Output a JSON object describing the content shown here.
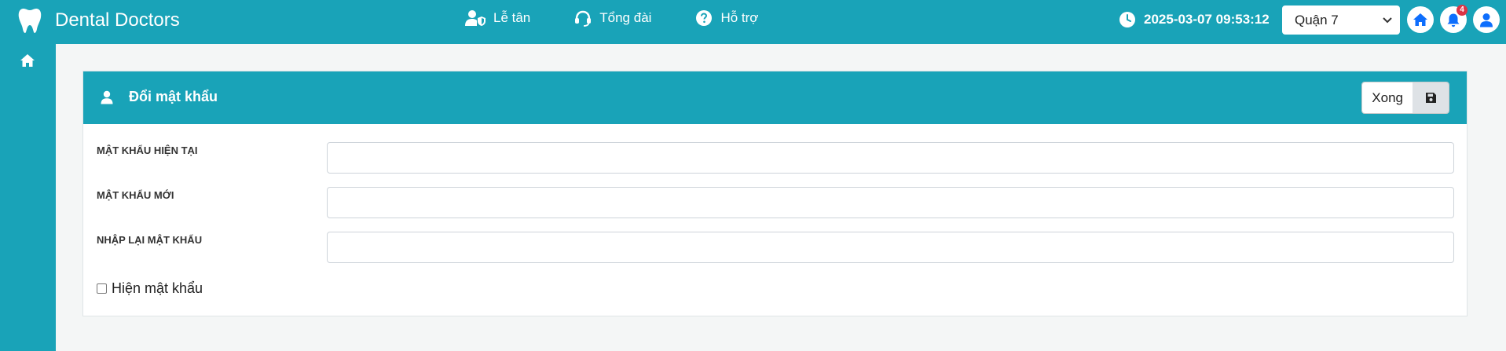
{
  "header": {
    "brand": "Dental Doctors",
    "nav": [
      {
        "label": "Lễ tân",
        "icon": "user-shield-icon"
      },
      {
        "label": "Tổng đài",
        "icon": "headset-icon"
      },
      {
        "label": "Hỗ trợ",
        "icon": "question-circle-icon"
      }
    ],
    "datetime": "2025-03-07 09:53:12",
    "branch": "Quận 7",
    "notification_count": "4"
  },
  "card": {
    "title": "Đổi mật khẩu",
    "done_label": "Xong",
    "fields": [
      {
        "label": "MẬT KHẨU HIỆN TẠI",
        "value": ""
      },
      {
        "label": "MẬT KHẨU MỚI",
        "value": ""
      },
      {
        "label": "NHẬP LẠI MẬT KHẨU",
        "value": ""
      }
    ],
    "show_password_label": "Hiện mật khẩu",
    "show_password_checked": false
  },
  "colors": {
    "primary": "#19a3b8",
    "accent": "#0d6efd",
    "badge": "#dc3545"
  }
}
